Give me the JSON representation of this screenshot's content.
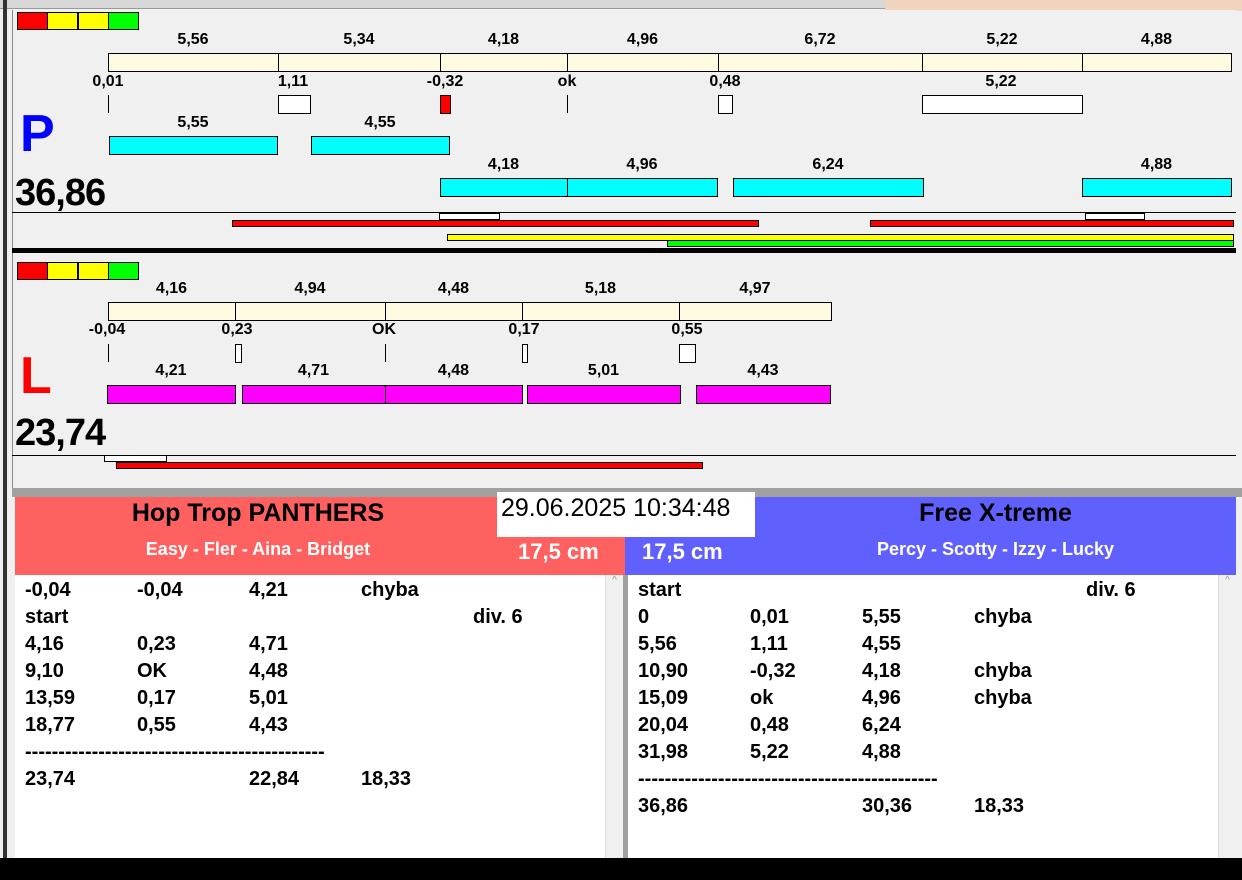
{
  "colors": {
    "red": "#ff0000",
    "yellow": "#ffff00",
    "green": "#00ff00",
    "cyan": "#00ffff",
    "magenta": "#ff00ff",
    "bar": "#fffbe3",
    "team_left": "#ff6060",
    "team_right": "#6060ff"
  },
  "p": {
    "letter": "P",
    "total": "36,86",
    "top_labels": [
      "5,56",
      "5,34",
      "4,18",
      "4,96",
      "6,72",
      "5,22",
      "4,88"
    ],
    "mid_labels": [
      "0,01",
      "1,11",
      "-0,32",
      "ok",
      "0,48",
      "5,22"
    ],
    "cyan1_labels": [
      "5,55",
      "4,55"
    ],
    "cyan2_labels": [
      "4,18",
      "4,96",
      "6,24",
      "4,88"
    ]
  },
  "l": {
    "letter": "L",
    "total": "23,74",
    "top_labels": [
      "4,16",
      "4,94",
      "4,48",
      "5,18",
      "4,97"
    ],
    "mid_labels": [
      "-0,04",
      "0,23",
      "OK",
      "0,17",
      "0,55"
    ],
    "mag_labels": [
      "4,21",
      "4,71",
      "4,48",
      "5,01",
      "4,43"
    ]
  },
  "datetime": "29.06.2025 10:34:48",
  "left_team": {
    "name": "Hop Trop PANTHERS",
    "dogs": "Easy - Fler - Aina - Bridget",
    "height": "17,5 cm",
    "rows": [
      [
        "-0,04",
        "-0,04",
        "4,21",
        "chyba",
        ""
      ],
      [
        "start",
        "",
        "",
        "",
        "div.  6"
      ],
      [
        "4,16",
        "0,23",
        "4,71",
        "",
        ""
      ],
      [
        "9,10",
        "OK",
        "4,48",
        "",
        ""
      ],
      [
        "13,59",
        "0,17",
        "5,01",
        "",
        ""
      ],
      [
        "18,77",
        "0,55",
        "4,43",
        "",
        ""
      ],
      [
        "---------------------------------------------",
        "",
        "",
        "",
        ""
      ],
      [
        "23,74",
        "",
        "22,84",
        "18,33",
        ""
      ]
    ]
  },
  "right_team": {
    "name": "Free X-treme",
    "dogs": "Percy - Scotty - Izzy - Lucky",
    "height": "17,5 cm",
    "rows": [
      [
        "start",
        "",
        "",
        "",
        "div.  6"
      ],
      [
        "0",
        "0,01",
        "5,55",
        "chyba",
        ""
      ],
      [
        "5,56",
        "1,11",
        "4,55",
        "",
        ""
      ],
      [
        "10,90",
        "-0,32",
        "4,18",
        "chyba",
        ""
      ],
      [
        "15,09",
        "ok",
        "4,96",
        "chyba",
        ""
      ],
      [
        "20,04",
        "0,48",
        "6,24",
        "",
        ""
      ],
      [
        "31,98",
        "5,22",
        "4,88",
        "",
        ""
      ],
      [
        "---------------------------------------------",
        "",
        "",
        "",
        ""
      ],
      [
        "36,86",
        "",
        "30,36",
        "18,33",
        ""
      ]
    ]
  }
}
